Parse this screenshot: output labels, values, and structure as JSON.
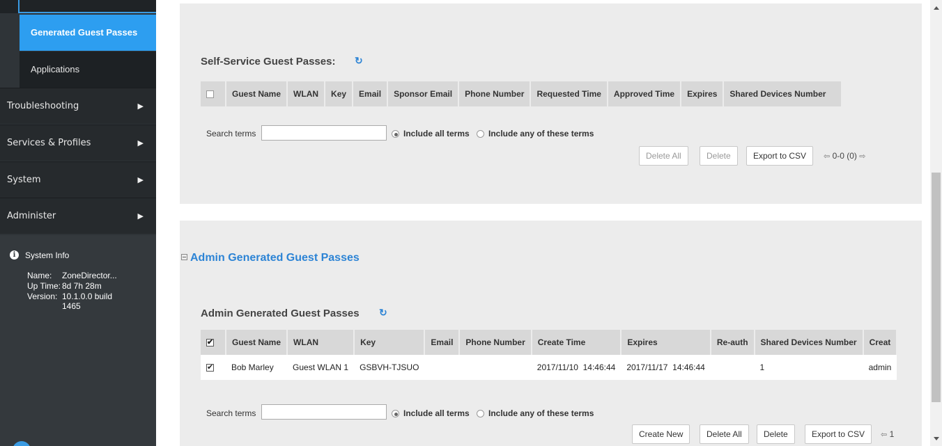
{
  "sidebar": {
    "sub_items": [
      {
        "label": "Generated Guest Passes",
        "active": true
      },
      {
        "label": "Applications",
        "active": false
      }
    ],
    "menu_items": [
      {
        "label": "Troubleshooting"
      },
      {
        "label": "Services & Profiles"
      },
      {
        "label": "System"
      },
      {
        "label": "Administer"
      }
    ],
    "system_info": {
      "heading": "System Info",
      "name_key": "Name:",
      "name_val": "ZoneDirector...",
      "uptime_key": "Up Time:",
      "uptime_val": "8d 7h 28m",
      "version_key": "Version:",
      "version_val": "10.1.0.0 build 1465"
    }
  },
  "self_service": {
    "title": "Self-Service Guest Passes:",
    "columns": [
      "Guest Name",
      "WLAN",
      "Key",
      "Email",
      "Sponsor Email",
      "Phone Number",
      "Requested Time",
      "Approved Time",
      "Expires",
      "Shared Devices Number"
    ],
    "search_label": "Search terms",
    "search_value": "",
    "radio_all": "Include all terms",
    "radio_any": "Include any of these terms",
    "btn_delete_all": "Delete All",
    "btn_delete": "Delete",
    "btn_export": "Export to CSV",
    "pager": "0-0 (0)"
  },
  "admin": {
    "section_link": "Admin Generated Guest Passes",
    "title": "Admin Generated Guest Passes",
    "columns": [
      "Guest Name",
      "WLAN",
      "Key",
      "Email",
      "Phone Number",
      "Create Time",
      "Expires",
      "Re-auth",
      "Shared Devices Number",
      "Creat"
    ],
    "rows": [
      {
        "checked": true,
        "guest_name": "Bob Marley",
        "wlan": "Guest WLAN 1",
        "key": "GSBVH-TJSUO",
        "email": "",
        "phone": "",
        "create_time": "2017/11/10  14:46:44",
        "expires": "2017/11/17  14:46:44",
        "reauth": "",
        "shared": "1",
        "creator": "admin"
      }
    ],
    "search_label": "Search terms",
    "search_value": "",
    "radio_all": "Include all terms",
    "radio_any": "Include any of these terms",
    "btn_create": "Create New",
    "btn_delete_all": "Delete All",
    "btn_delete": "Delete",
    "btn_export": "Export to CSV",
    "pager": "1"
  },
  "icons": {
    "refresh": "refresh-icon",
    "info": "info-icon",
    "arrow": "arrow-right-icon"
  },
  "colors": {
    "sidebar_bg": "#2f3438",
    "active_item": "#2d9ef0",
    "link": "#2d84d5",
    "panel_bg": "#ececec"
  }
}
